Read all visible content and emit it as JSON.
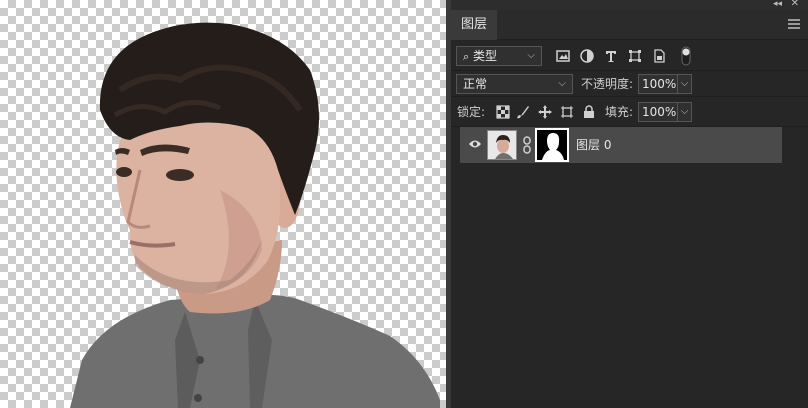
{
  "panel": {
    "tab_label": "图层",
    "filter": {
      "icon": "search-icon",
      "value": "类型"
    },
    "blend_mode": "正常",
    "opacity_label": "不透明度:",
    "opacity_value": "100%",
    "lock_label": "锁定:",
    "fill_label": "填充:",
    "fill_value": "100%"
  },
  "layers": [
    {
      "name": "图层 0",
      "visible": true,
      "has_mask": true
    }
  ],
  "colors": {
    "panel_bg": "#262626",
    "selected_layer": "#4a4a4a",
    "checker_light": "#ffffff",
    "checker_dark": "#cccccc"
  }
}
